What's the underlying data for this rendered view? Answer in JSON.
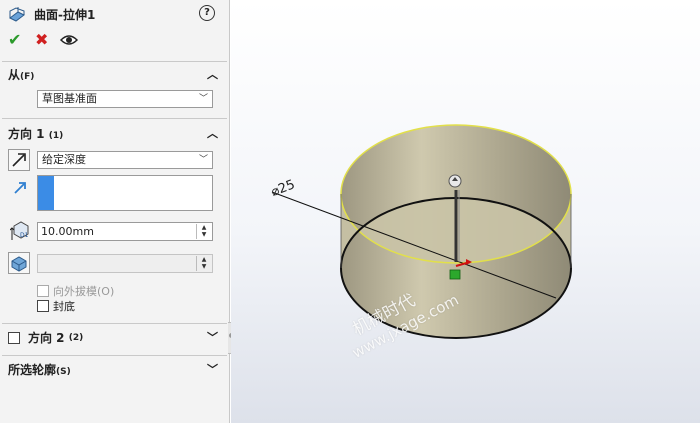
{
  "panel": {
    "title": "曲面-拉伸1",
    "help_icon": "?",
    "actions": {
      "ok": "✔",
      "cancel": "✖",
      "preview": "👁"
    },
    "from": {
      "label": "从",
      "shortcut": "(F)",
      "value": "草图基准面"
    },
    "direction1": {
      "label": "方向 1",
      "shortcut": "(1)",
      "end_condition": "给定深度",
      "depth": "10.00mm",
      "draft_value": "",
      "draft_outward": "向外拔模(O)",
      "cap_end": "封底"
    },
    "direction2": {
      "label": "方向 2",
      "shortcut": "(2)"
    },
    "selected_contours": {
      "label": "所选轮廓",
      "shortcut": "(S)"
    }
  },
  "viewport": {
    "dimension_label": "⌀25",
    "watermark_cn": "机械时代",
    "watermark_url": "www.jxage.com"
  },
  "colors": {
    "surface": "#b9b39a",
    "surface_edge": "#e2e04a",
    "accent_blue": "#3b8ce6"
  }
}
